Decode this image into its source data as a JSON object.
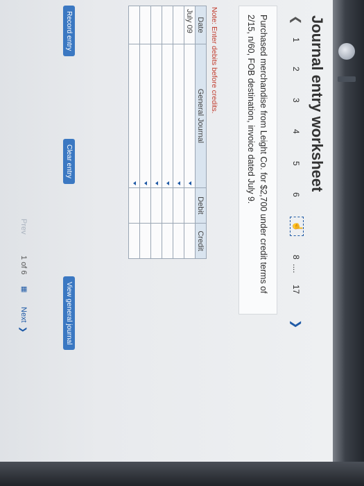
{
  "title": "Journal entry worksheet",
  "steps": [
    "1",
    "2",
    "3",
    "4",
    "5",
    "6",
    "8",
    "17"
  ],
  "step_ellipsis": "....",
  "question": "Purchased merchandise from Leight Co. for $2,700 under credit terms of 2/15, n/60, FOB destination, invoice dated July 9.",
  "note": "Note: Enter debits before credits.",
  "journal": {
    "headers": [
      "Date",
      "General Journal",
      "Debit",
      "Credit"
    ],
    "rows": [
      [
        "July 09",
        "",
        "",
        ""
      ],
      [
        "",
        "",
        "",
        ""
      ],
      [
        "",
        "",
        "",
        ""
      ],
      [
        "",
        "",
        "",
        ""
      ],
      [
        "",
        "",
        "",
        ""
      ],
      [
        "",
        "",
        "",
        ""
      ]
    ]
  },
  "buttons": {
    "record": "Record entry",
    "clear": "Clear entry",
    "view": "View general journal"
  },
  "pager": {
    "prev": "Prev",
    "position": "1 of 6",
    "next": "Next"
  },
  "colors": {
    "accent": "#3b78c2",
    "header_bg": "#d9e4ef",
    "note": "#c0392b"
  }
}
